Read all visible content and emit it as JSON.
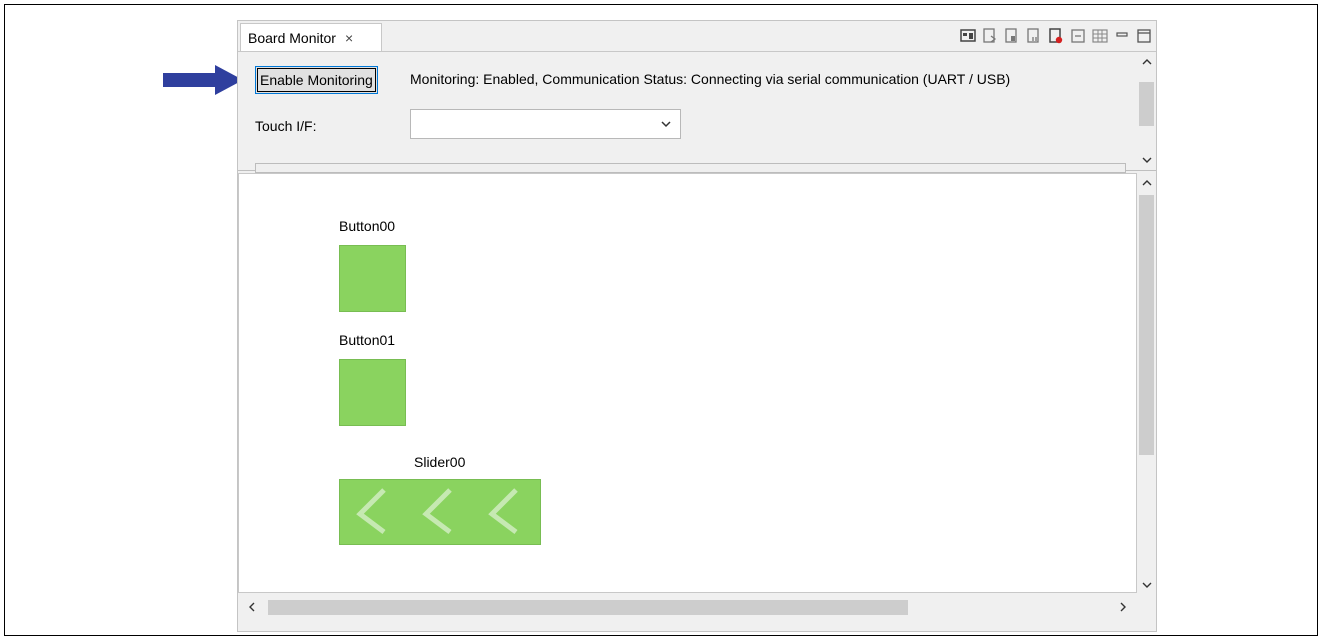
{
  "view": {
    "tab_title": "Board Monitor",
    "tab_close_icon": "×"
  },
  "toolbar_icons": [
    "monitor-view-icon",
    "step-in-icon",
    "step-icon",
    "step-out-icon",
    "record-icon",
    "collapse-icon",
    "table-icon",
    "minimize-icon",
    "maximize-icon"
  ],
  "top": {
    "enable_button_label": "Enable Monitoring",
    "status_text": "Monitoring: Enabled, Communication Status: Connecting via serial communication (UART / USB)",
    "touch_if_label": "Touch I/F:",
    "touch_if_value": ""
  },
  "canvas": {
    "button00_label": "Button00",
    "button01_label": "Button01",
    "slider00_label": "Slider00"
  },
  "colors": {
    "widget_green": "#8ad35f",
    "arrow_blue": "#2f3f9e",
    "accent": "#0078d7"
  }
}
